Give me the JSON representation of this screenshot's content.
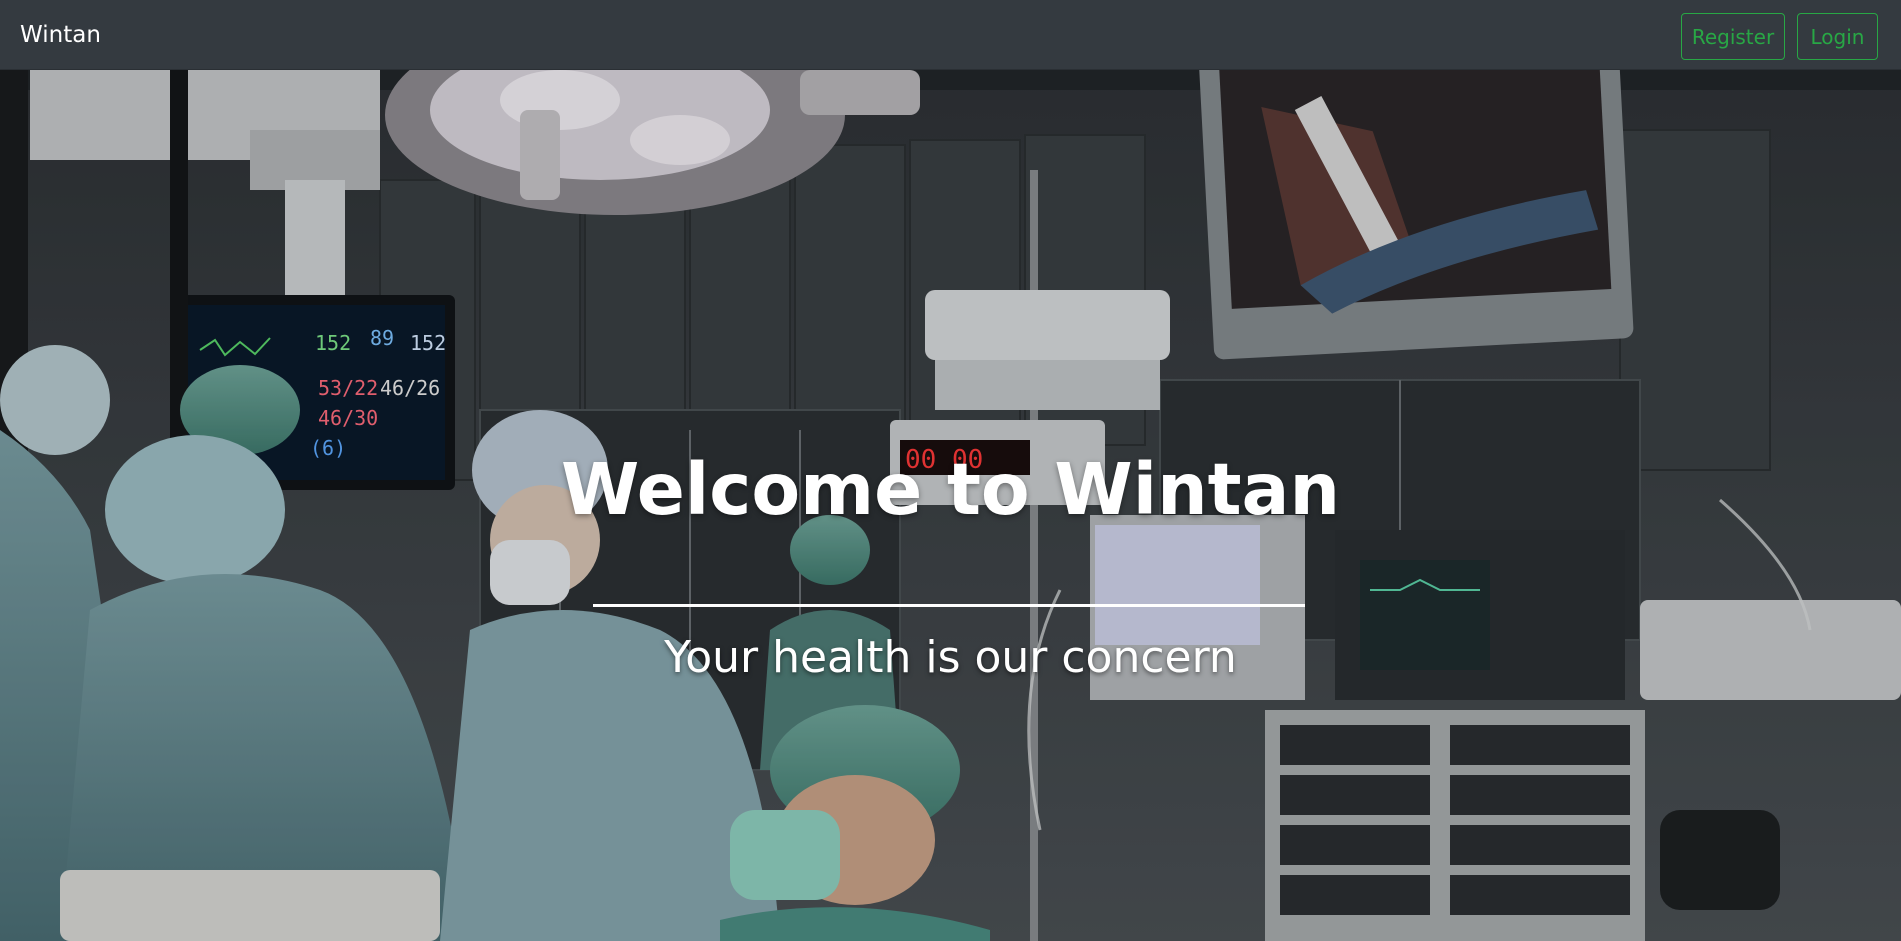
{
  "navbar": {
    "brand": "Wintan",
    "register_label": "Register",
    "login_label": "Login"
  },
  "hero": {
    "title": "Welcome to Wintan",
    "subtitle": "Your health is our concern",
    "background_icon": "operating-room-photo"
  },
  "colors": {
    "navbar_bg": "#343a40",
    "accent_green": "#28a745",
    "text_white": "#ffffff"
  }
}
